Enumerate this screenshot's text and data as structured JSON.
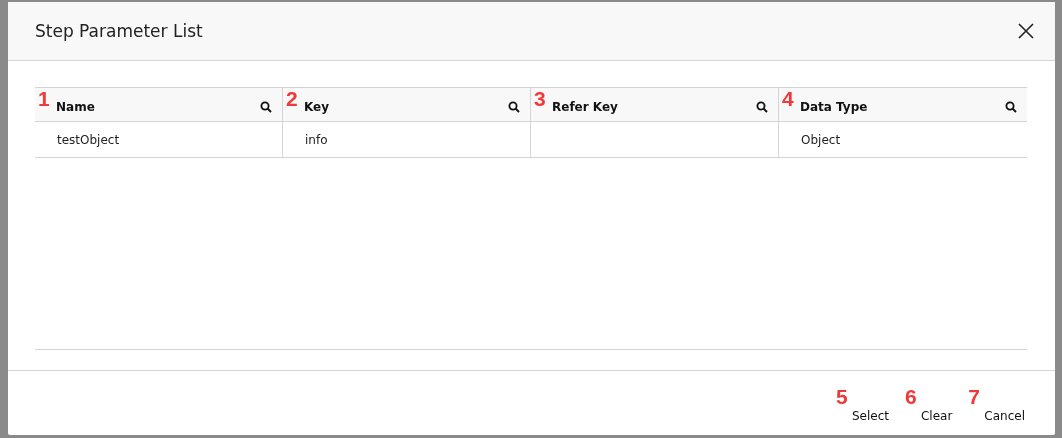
{
  "dialog": {
    "title": "Step Parameter List"
  },
  "table": {
    "columns": [
      {
        "label": "Name",
        "marker": "1"
      },
      {
        "label": "Key",
        "marker": "2"
      },
      {
        "label": "Refer Key",
        "marker": "3"
      },
      {
        "label": "Data Type",
        "marker": "4"
      }
    ],
    "rows": [
      {
        "cells": [
          "testObject",
          "info",
          "",
          "Object"
        ]
      }
    ]
  },
  "buttons": [
    {
      "label": "Select",
      "marker": "5"
    },
    {
      "label": "Clear",
      "marker": "6"
    },
    {
      "label": "Cancel",
      "marker": "7"
    }
  ]
}
